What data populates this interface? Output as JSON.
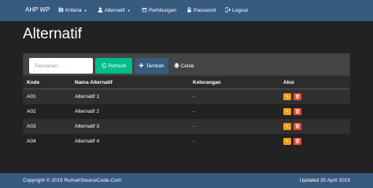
{
  "navbar": {
    "brand": "AHP WP",
    "items": [
      {
        "label": "Kriteria",
        "icon": "books-icon"
      },
      {
        "label": "Alternatif",
        "icon": "user-icon"
      },
      {
        "label": "Perhitungan",
        "icon": "calendar-icon"
      },
      {
        "label": "Password",
        "icon": "lock-icon"
      },
      {
        "label": "Logout",
        "icon": "logout-icon"
      }
    ]
  },
  "page": {
    "title": "Alternatif"
  },
  "toolbar": {
    "search_placeholder": "Pencarian. . .",
    "search_value": "",
    "refresh_label": "Refresh",
    "tambah_label": "Tambah",
    "cetak_label": "Cetak"
  },
  "table": {
    "headers": [
      "Kode",
      "Nama Alternatif",
      "Keterangan",
      "Aksi"
    ],
    "rows": [
      {
        "kode": "A01",
        "nama": "Alternatif 1",
        "keterangan": "-"
      },
      {
        "kode": "A02",
        "nama": "Alternatif 2",
        "keterangan": "-"
      },
      {
        "kode": "A03",
        "nama": "Alternatif 3",
        "keterangan": "-"
      },
      {
        "kode": "A04",
        "nama": "Alternatif 4",
        "keterangan": "-"
      }
    ]
  },
  "footer": {
    "copyright": "Copyright © 2019 RumahSourceCode.Com",
    "updated": "Updated 30 April 2019"
  },
  "colors": {
    "navbar": "#375a7f",
    "background": "#222222",
    "success": "#00bc8c",
    "warning": "#f39c12",
    "danger": "#e74c3c"
  }
}
